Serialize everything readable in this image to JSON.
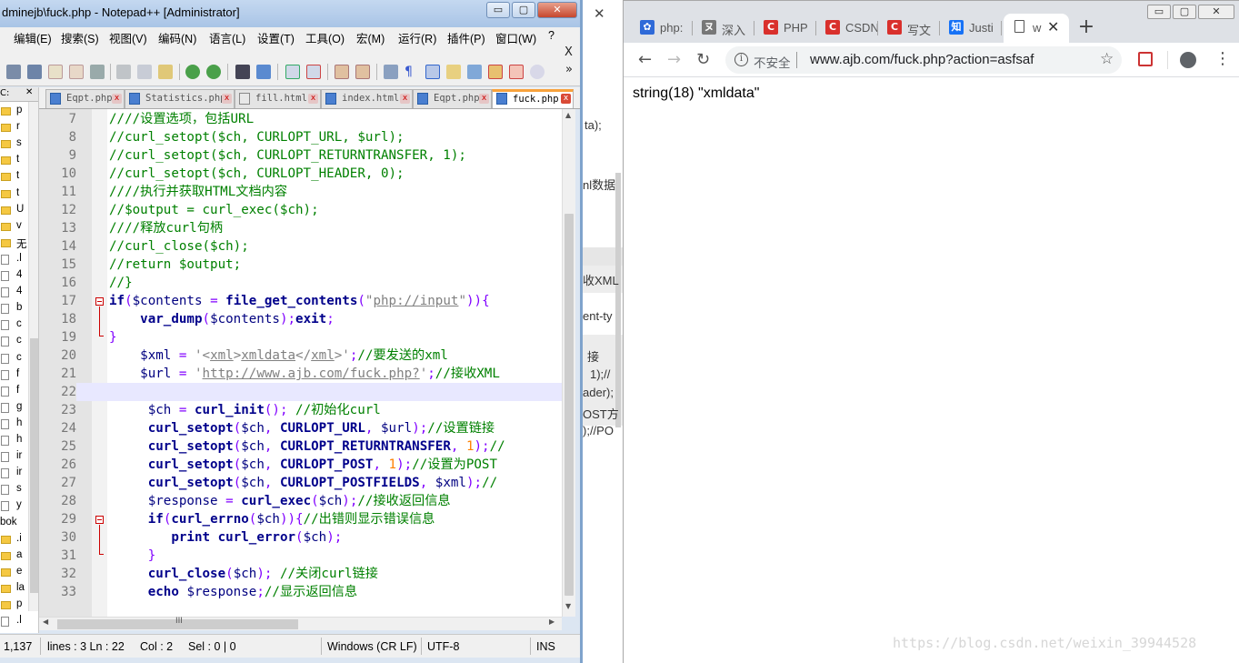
{
  "notepad": {
    "title": "dminejb\\fuck.php - Notepad++ [Administrator]",
    "window_buttons": {
      "minimize": "▭",
      "maximize": "▢",
      "close": "✕"
    },
    "menu": [
      "编辑(E)",
      "搜索(S)",
      "视图(V)",
      "编码(N)",
      "语言(L)",
      "设置(T)",
      "工具(O)",
      "宏(M)",
      "运行(R)",
      "插件(P)",
      "窗口(W)",
      "?"
    ],
    "menu_close": "X",
    "toolbar_overflow": "»",
    "tabs": [
      {
        "label": "Eqpt.php",
        "active": false
      },
      {
        "label": "Statistics.php",
        "active": false
      },
      {
        "label": "fill.html",
        "active": false
      },
      {
        "label": "index.html",
        "active": false
      },
      {
        "label": "Eqpt.php",
        "active": false
      },
      {
        "label": "fuck.php",
        "active": true
      }
    ],
    "tab_close": "x",
    "left_panel": {
      "header": "C:",
      "rows": [
        {
          "name": "p",
          "type": "folder"
        },
        {
          "name": "r",
          "type": "folder"
        },
        {
          "name": "s",
          "type": "folder"
        },
        {
          "name": "t",
          "type": "folder"
        },
        {
          "name": "t",
          "type": "folder"
        },
        {
          "name": "t",
          "type": "folder"
        },
        {
          "name": "U",
          "type": "folder"
        },
        {
          "name": "v",
          "type": "folder"
        },
        {
          "name": "无",
          "type": "folder"
        },
        {
          "name": ".l",
          "type": "file"
        },
        {
          "name": "4",
          "type": "file"
        },
        {
          "name": "4",
          "type": "file"
        },
        {
          "name": "b",
          "type": "file"
        },
        {
          "name": "c",
          "type": "file"
        },
        {
          "name": "c",
          "type": "file"
        },
        {
          "name": "c",
          "type": "file"
        },
        {
          "name": "f",
          "type": "file"
        },
        {
          "name": "f",
          "type": "file"
        },
        {
          "name": "g",
          "type": "file"
        },
        {
          "name": "h",
          "type": "file"
        },
        {
          "name": "h",
          "type": "file"
        },
        {
          "name": "ir",
          "type": "file"
        },
        {
          "name": "ir",
          "type": "file"
        },
        {
          "name": "s",
          "type": "file"
        },
        {
          "name": "y",
          "type": "file"
        },
        {
          "name": "bok",
          "type": "label"
        },
        {
          "name": ".i",
          "type": "folder"
        },
        {
          "name": "a",
          "type": "folder"
        },
        {
          "name": "e",
          "type": "folder"
        },
        {
          "name": "la",
          "type": "folder"
        },
        {
          "name": "p",
          "type": "folder"
        },
        {
          "name": ".l",
          "type": "file"
        }
      ]
    },
    "code_lines": [
      {
        "n": "7",
        "html": "<span class=\"t-cm\">////设置选项，包括URL</span>"
      },
      {
        "n": "8",
        "html": "<span class=\"t-cm\">//curl_setopt($ch, CURLOPT_URL, $url);</span>"
      },
      {
        "n": "9",
        "html": "<span class=\"t-cm\">//curl_setopt($ch, CURLOPT_RETURNTRANSFER, 1);</span>"
      },
      {
        "n": "10",
        "html": "<span class=\"t-cm\">//curl_setopt($ch, CURLOPT_HEADER, 0);</span>"
      },
      {
        "n": "11",
        "html": "<span class=\"t-cm\">////执行并获取HTML文档内容</span>"
      },
      {
        "n": "12",
        "html": "<span class=\"t-cm\">//$output = curl_exec($ch);</span>"
      },
      {
        "n": "13",
        "html": "<span class=\"t-cm\">////释放curl句柄</span>"
      },
      {
        "n": "14",
        "html": "<span class=\"t-cm\">//curl_close($ch);</span>"
      },
      {
        "n": "15",
        "html": "<span class=\"t-cm\">//return $output;</span>"
      },
      {
        "n": "16",
        "html": "<span class=\"t-cm\">//}</span>"
      },
      {
        "n": "17",
        "html": "<span class=\"t-kw\">if</span><span class=\"t-op\">(</span><span class=\"t-var\">$contents</span> <span class=\"t-op\">=</span> <span class=\"t-fn\">file_get_contents</span><span class=\"t-op\">(</span><span class=\"t-str\">\"<u>php://input</u>\"</span><span class=\"t-op\">)){</span>"
      },
      {
        "n": "18",
        "html": "    <span class=\"t-fn\">var_dump</span><span class=\"t-op\">(</span><span class=\"t-var\">$contents</span><span class=\"t-op\">);</span><span class=\"t-kw\">exit</span><span class=\"t-op\">;</span>"
      },
      {
        "n": "19",
        "html": "<span class=\"t-op\">}</span>"
      },
      {
        "n": "20",
        "html": "    <span class=\"t-var\">$xml</span> <span class=\"t-op\">=</span> <span class=\"t-str\">'&lt;<u>xml</u>&gt;<u>xmldata</u>&lt;/<u>xml</u>&gt;'</span><span class=\"t-op\">;</span><span class=\"t-cm\">//要发送的xml</span>"
      },
      {
        "n": "21",
        "html": "    <span class=\"t-var\">$url</span> <span class=\"t-op\">=</span> <span class=\"t-str\">'<u>http://www.ajb.com/fuck.php?</u>'</span><span class=\"t-op\">;</span><span class=\"t-cm\">//接收XML</span>"
      },
      {
        "n": "22",
        "html": ""
      },
      {
        "n": "23",
        "html": "     <span class=\"t-var\">$ch</span> <span class=\"t-op\">=</span> <span class=\"t-fn\">curl_init</span><span class=\"t-op\">();</span> <span class=\"t-cm\">//初始化curl</span>"
      },
      {
        "n": "24",
        "html": "     <span class=\"t-fn\">curl_setopt</span><span class=\"t-op\">(</span><span class=\"t-var\">$ch</span><span class=\"t-op\">,</span> <span class=\"t-kw\">CURLOPT_URL</span><span class=\"t-op\">,</span> <span class=\"t-var\">$url</span><span class=\"t-op\">);</span><span class=\"t-cm\">//设置链接</span>"
      },
      {
        "n": "25",
        "html": "     <span class=\"t-fn\">curl_setopt</span><span class=\"t-op\">(</span><span class=\"t-var\">$ch</span><span class=\"t-op\">,</span> <span class=\"t-kw\">CURLOPT_RETURNTRANSFER</span><span class=\"t-op\">,</span> <span class=\"t-num\">1</span><span class=\"t-op\">);</span><span class=\"t-cm\">//</span>"
      },
      {
        "n": "26",
        "html": "     <span class=\"t-fn\">curl_setopt</span><span class=\"t-op\">(</span><span class=\"t-var\">$ch</span><span class=\"t-op\">,</span> <span class=\"t-kw\">CURLOPT_POST</span><span class=\"t-op\">,</span> <span class=\"t-num\">1</span><span class=\"t-op\">);</span><span class=\"t-cm\">//设置为POST</span>"
      },
      {
        "n": "27",
        "html": "     <span class=\"t-fn\">curl_setopt</span><span class=\"t-op\">(</span><span class=\"t-var\">$ch</span><span class=\"t-op\">,</span> <span class=\"t-kw\">CURLOPT_POSTFIELDS</span><span class=\"t-op\">,</span> <span class=\"t-var\">$xml</span><span class=\"t-op\">);</span><span class=\"t-cm\">//</span>"
      },
      {
        "n": "28",
        "html": "     <span class=\"t-var\">$response</span> <span class=\"t-op\">=</span> <span class=\"t-fn\">curl_exec</span><span class=\"t-op\">(</span><span class=\"t-var\">$ch</span><span class=\"t-op\">);</span><span class=\"t-cm\">//接收返回信息</span>"
      },
      {
        "n": "29",
        "html": "     <span class=\"t-kw\">if</span><span class=\"t-op\">(</span><span class=\"t-fn\">curl_errno</span><span class=\"t-op\">(</span><span class=\"t-var\">$ch</span><span class=\"t-op\">)){</span><span class=\"t-cm\">//出错则显示错误信息</span>"
      },
      {
        "n": "30",
        "html": "        <span class=\"t-kw\">print</span> <span class=\"t-fn\">curl_error</span><span class=\"t-op\">(</span><span class=\"t-var\">$ch</span><span class=\"t-op\">);</span>"
      },
      {
        "n": "31",
        "html": "     <span class=\"t-op\">}</span>"
      },
      {
        "n": "32",
        "html": "     <span class=\"t-fn\">curl_close</span><span class=\"t-op\">(</span><span class=\"t-var\">$ch</span><span class=\"t-op\">);</span> <span class=\"t-cm\">//关闭curl链接</span>"
      },
      {
        "n": "33",
        "html": "     <span class=\"t-kw\">echo</span> <span class=\"t-var\">$response</span><span class=\"t-op\">;</span><span class=\"t-cm\">//显示返回信息</span>"
      }
    ],
    "current_line": "22",
    "hscroll_grip": "III",
    "status": {
      "pos": "1,137",
      "lines": "lines : 3  Ln : 22",
      "col": "Col : 2",
      "sel": "Sel : 0 | 0",
      "eol": "Windows (CR LF)",
      "encoding": "UTF-8",
      "mode": "INS"
    }
  },
  "background_window": {
    "close": "✕",
    "fragments": [
      "ta);",
      "nl数据",
      "收XML",
      "ent-ty",
      "接",
      "1);//",
      "ader);",
      "OST方",
      ");//PO"
    ]
  },
  "chrome": {
    "window_buttons": {
      "minimize": "▭",
      "maximize": "▢",
      "close": "✕"
    },
    "tabs": [
      {
        "label": "php:",
        "favicon": "paw",
        "color": "#2f6ad8",
        "glyph": "✿"
      },
      {
        "label": "深入",
        "favicon": "mask",
        "color": "#777777",
        "glyph": "ヌ"
      },
      {
        "label": "PHP",
        "favicon": "csdn",
        "color": "#d9302c",
        "glyph": "C"
      },
      {
        "label": "CSDN",
        "favicon": "csdn",
        "color": "#d9302c",
        "glyph": "C"
      },
      {
        "label": "写文",
        "favicon": "csdn",
        "color": "#d9302c",
        "glyph": "C"
      },
      {
        "label": "Justi",
        "favicon": "zhihu",
        "color": "#1772f6",
        "glyph": "知"
      }
    ],
    "active_tab": {
      "label": "w",
      "close": "✕"
    },
    "new_tab": "+",
    "nav": {
      "back": "←",
      "forward": "→",
      "reload": "↻"
    },
    "omnibox": {
      "security": "不安全",
      "url": "www.ajb.com/fuck.php?action=asfsaf",
      "info": "i",
      "star": "☆"
    },
    "menu": "⋮",
    "page_output": "string(18) \"xmldata\"",
    "watermark": "https://blog.csdn.net/weixin_39944528"
  }
}
